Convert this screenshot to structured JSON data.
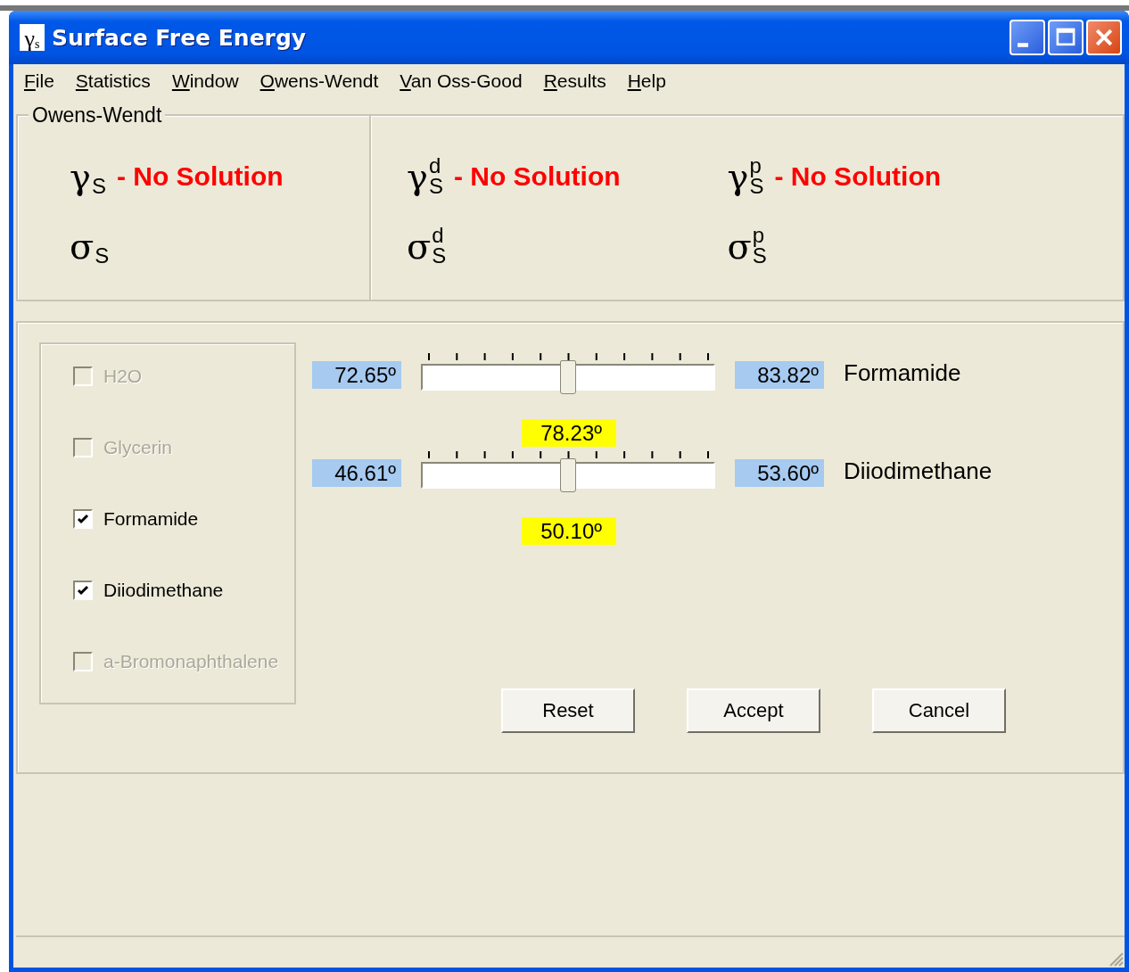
{
  "window": {
    "icon": {
      "symbol": "γ",
      "sub": "s"
    },
    "title": "Surface Free Energy"
  },
  "menu": [
    {
      "label": "File"
    },
    {
      "label": "Statistics"
    },
    {
      "label": "Window"
    },
    {
      "label": "Owens-Wendt"
    },
    {
      "label": "Van Oss-Good"
    },
    {
      "label": "Results"
    },
    {
      "label": "Help"
    }
  ],
  "results_group": {
    "title": "Owens-Wendt",
    "columns": [
      {
        "gamma": {
          "symbol": "γ",
          "sub": "S"
        },
        "status": "- No Solution",
        "sigma": {
          "symbol": "σ",
          "sub": "S"
        }
      },
      {
        "gamma": {
          "symbol": "γ",
          "sup": "d",
          "sub": "S"
        },
        "status": "- No Solution",
        "sigma": {
          "symbol": "σ",
          "sup": "d",
          "sub": "S"
        }
      },
      {
        "gamma": {
          "symbol": "γ",
          "sup": "p",
          "sub": "S"
        },
        "status": "- No Solution",
        "sigma": {
          "symbol": "σ",
          "sup": "p",
          "sub": "S"
        }
      }
    ]
  },
  "liquids": [
    {
      "label": "H2O",
      "checked": false,
      "disabled": true
    },
    {
      "label": "Glycerin",
      "checked": false,
      "disabled": true
    },
    {
      "label": "Formamide",
      "checked": true,
      "disabled": false
    },
    {
      "label": "Diiodimethane",
      "checked": true,
      "disabled": false
    },
    {
      "label": "a-Bromonaphthalene",
      "checked": false,
      "disabled": true
    }
  ],
  "sliders": [
    {
      "min": "72.65º",
      "max": "83.82º",
      "name": "Formamide",
      "level": 0.5,
      "value": "78.23º"
    },
    {
      "min": "46.61º",
      "max": "53.60º",
      "name": "Diiodimethane",
      "level": 0.5,
      "value": "50.10º"
    }
  ],
  "buttons": [
    "Reset",
    "Accept",
    "Cancel"
  ]
}
